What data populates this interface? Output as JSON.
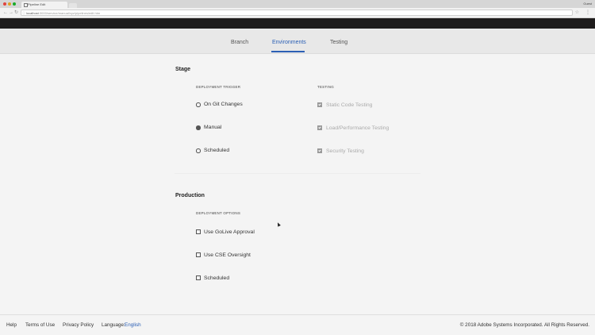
{
  "browser": {
    "tab_title": "Pipeline Edit",
    "url_host": "localhost",
    "url_path": ":3000/service/manual/xyz/pipelines/edit.htm",
    "user": "Guest",
    "colors": {
      "close": "#e0443e",
      "minimize": "#dea123",
      "maximize": "#1aab29"
    }
  },
  "tabs": {
    "branch": "Branch",
    "environments": "Environments",
    "testing": "Testing",
    "active": "Environments",
    "active_color": "#2c60b5"
  },
  "stage": {
    "title": "Stage",
    "trigger_header": "DEPLOYMENT TRIGGER",
    "triggers": [
      {
        "label": "On Git Changes",
        "selected": false
      },
      {
        "label": "Manual",
        "selected": true
      },
      {
        "label": "Scheduled",
        "selected": false
      }
    ],
    "testing_header": "TESTING",
    "tests": [
      {
        "label": "Static Code Testing",
        "checked": true,
        "disabled": true
      },
      {
        "label": "Load/Performance Testing",
        "checked": true,
        "disabled": true
      },
      {
        "label": "Security Testing",
        "checked": true,
        "disabled": true
      }
    ]
  },
  "production": {
    "title": "Production",
    "options_header": "DEPLOYMENT OPTIONS",
    "options": [
      {
        "label": "Use GoLive Approval",
        "checked": false
      },
      {
        "label": "Use CSE Oversight",
        "checked": false
      },
      {
        "label": "Scheduled",
        "checked": false
      }
    ]
  },
  "footer": {
    "help": "Help",
    "terms": "Terms of Use",
    "privacy": "Privacy Policy",
    "language_label": "Language:",
    "language_value": "English",
    "copyright": "© 2018 Adobe Systems Incorporated. All Rights Reserved."
  }
}
